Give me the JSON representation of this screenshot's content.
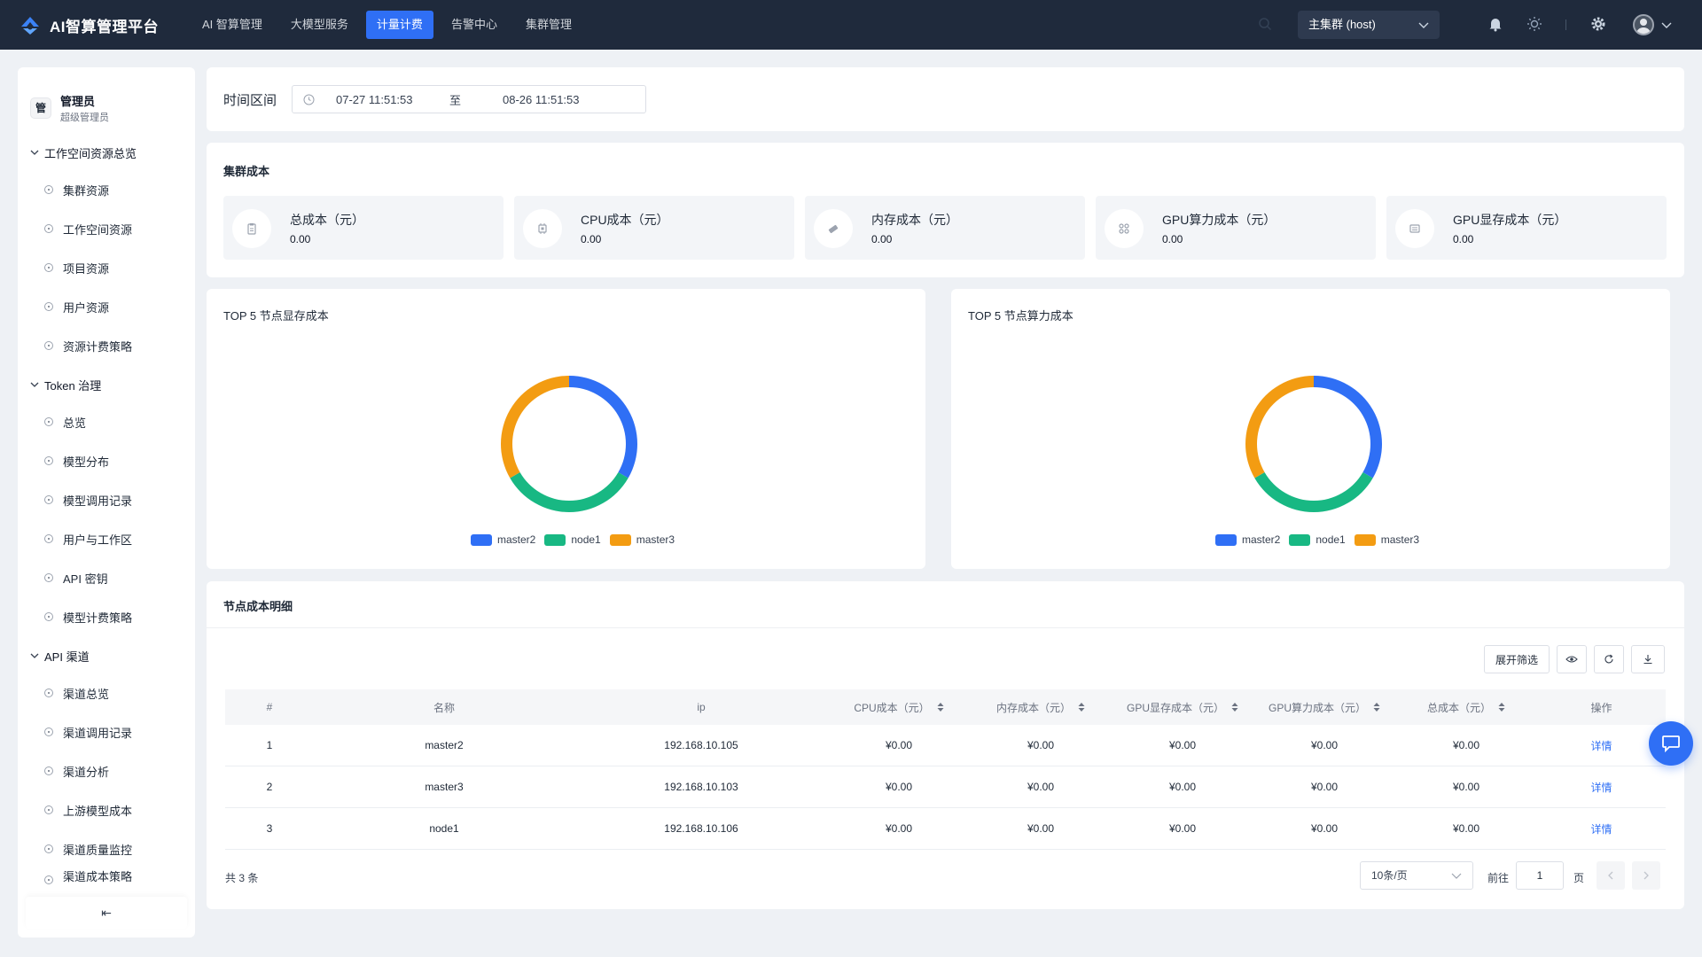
{
  "app": {
    "title": "AI智算管理平台"
  },
  "nav": [
    "AI 智算管理",
    "大模型服务",
    "计量计费",
    "告警中心",
    "集群管理"
  ],
  "nav_active": 2,
  "header": {
    "cluster": "主集群 (host)"
  },
  "user": {
    "badge": "管",
    "name": "管理员",
    "role": "超级管理员"
  },
  "sidebar": {
    "groups": [
      {
        "title": "工作空间资源总览",
        "items": [
          "集群资源",
          "工作空间资源",
          "项目资源",
          "用户资源",
          "资源计费策略"
        ]
      },
      {
        "title": "Token 治理",
        "items": [
          "总览",
          "模型分布",
          "模型调用记录",
          "用户与工作区",
          "API 密钥",
          "模型计费策略"
        ]
      },
      {
        "title": "API 渠道",
        "items": [
          "渠道总览",
          "渠道调用记录",
          "渠道分析",
          "上游模型成本",
          "渠道质量监控",
          "渠道成本策略"
        ]
      }
    ],
    "collapse_glyph": "⇤"
  },
  "time": {
    "label": "时间区间",
    "start": "07-27 11:51:53",
    "separator": "至",
    "end": "08-26 11:51:53"
  },
  "cluster_cost": {
    "title": "集群成本",
    "stats": [
      {
        "label": "总成本（元）",
        "value": "0.00",
        "icon": "clipboard-icon"
      },
      {
        "label": "CPU成本（元）",
        "value": "0.00",
        "icon": "cpu-icon"
      },
      {
        "label": "内存成本（元）",
        "value": "0.00",
        "icon": "memory-icon"
      },
      {
        "label": "GPU算力成本（元）",
        "value": "0.00",
        "icon": "grid-icon"
      },
      {
        "label": "GPU显存成本（元）",
        "value": "0.00",
        "icon": "gpu-card-icon"
      }
    ]
  },
  "charts": [
    {
      "title": "TOP 5 节点显存成本"
    },
    {
      "title": "TOP 5 节点算力成本"
    }
  ],
  "chart_data": [
    {
      "type": "pie",
      "title": "TOP 5 节点显存成本",
      "categories": [
        "master2",
        "node1",
        "master3"
      ],
      "values": [
        1,
        1,
        1
      ],
      "colors": [
        "#2f6ff5",
        "#18b883",
        "#f39c12"
      ],
      "legend": "bottom",
      "donut": true
    },
    {
      "type": "pie",
      "title": "TOP 5 节点算力成本",
      "categories": [
        "master2",
        "node1",
        "master3"
      ],
      "values": [
        1,
        1,
        1
      ],
      "colors": [
        "#2f6ff5",
        "#18b883",
        "#f39c12"
      ],
      "legend": "bottom",
      "donut": true
    }
  ],
  "table": {
    "title": "节点成本明细",
    "filter_button": "展开筛选",
    "columns": [
      "#",
      "名称",
      "ip",
      "CPU成本（元）",
      "内存成本（元）",
      "GPU显存成本（元）",
      "GPU算力成本（元）",
      "总成本（元）",
      "操作"
    ],
    "rows": [
      [
        "1",
        "master2",
        "192.168.10.105",
        "¥0.00",
        "¥0.00",
        "¥0.00",
        "¥0.00",
        "¥0.00",
        "详情"
      ],
      [
        "2",
        "master3",
        "192.168.10.103",
        "¥0.00",
        "¥0.00",
        "¥0.00",
        "¥0.00",
        "¥0.00",
        "详情"
      ],
      [
        "3",
        "node1",
        "192.168.10.106",
        "¥0.00",
        "¥0.00",
        "¥0.00",
        "¥0.00",
        "¥0.00",
        "详情"
      ]
    ],
    "total": "共 3 条",
    "page_size": "10条/页",
    "goto_label": "前往",
    "page": "1",
    "page_unit": "页"
  }
}
